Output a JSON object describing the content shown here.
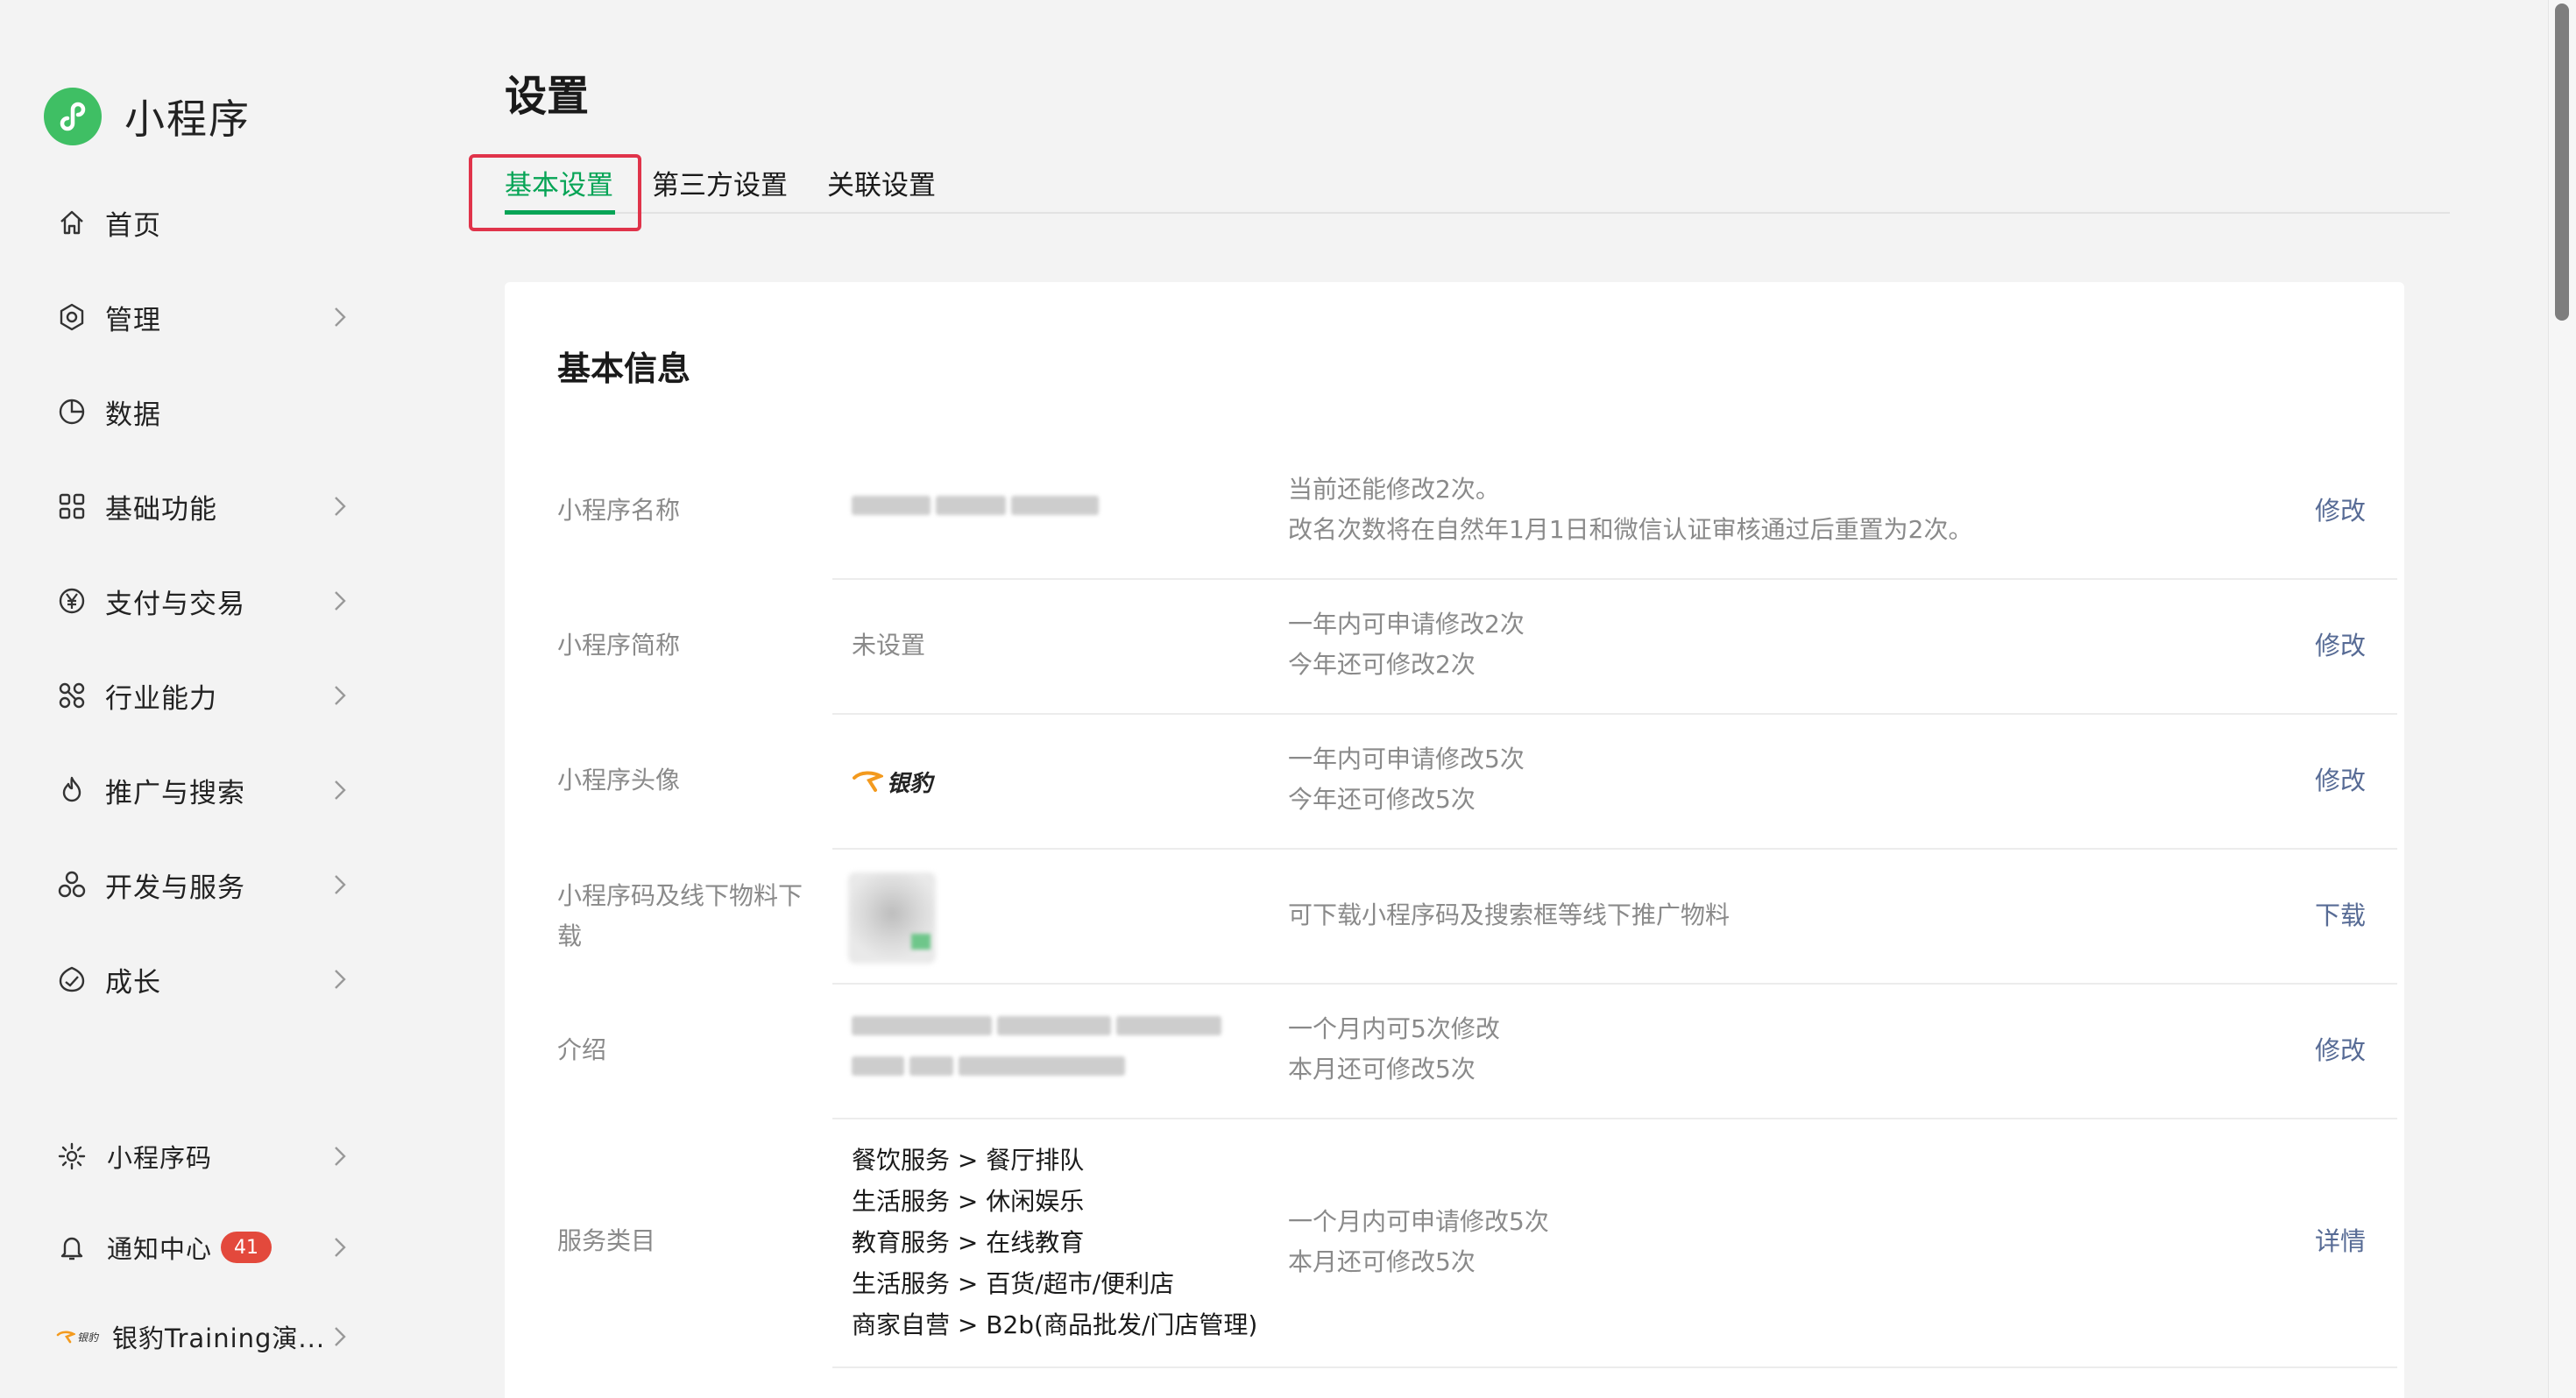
{
  "brand": {
    "name": "小程序"
  },
  "nav": [
    {
      "label": "首页",
      "icon": "home-icon",
      "chevron": false
    },
    {
      "label": "管理",
      "icon": "manage-icon",
      "chevron": true
    },
    {
      "label": "数据",
      "icon": "pie-chart-icon",
      "chevron": false
    },
    {
      "label": "基础功能",
      "icon": "grid-icon",
      "chevron": true
    },
    {
      "label": "支付与交易",
      "icon": "yen-icon",
      "chevron": true
    },
    {
      "label": "行业能力",
      "icon": "industry-icon",
      "chevron": true
    },
    {
      "label": "推广与搜索",
      "icon": "flame-icon",
      "chevron": true
    },
    {
      "label": "开发与服务",
      "icon": "cluster-icon",
      "chevron": true
    },
    {
      "label": "成长",
      "icon": "growth-icon",
      "chevron": true
    }
  ],
  "bottom_nav": {
    "qrcode": {
      "label": "小程序码"
    },
    "notify": {
      "label": "通知中心",
      "badge": "41"
    },
    "account": {
      "label": "银豹Training演...",
      "logo_text": "银豹"
    }
  },
  "page": {
    "title": "设置",
    "tabs": [
      "基本设置",
      "第三方设置",
      "关联设置"
    ],
    "active_tab": "基本设置"
  },
  "card": {
    "title": "基本信息",
    "rows": [
      {
        "label": "小程序名称",
        "desc": [
          "当前还能修改2次。",
          "改名次数将在自然年1月1日和微信认证审核通过后重置为2次。"
        ],
        "action": "修改"
      },
      {
        "label": "小程序简称",
        "value": "未设置",
        "desc": [
          "一年内可申请修改2次",
          "今年还可修改2次"
        ],
        "action": "修改"
      },
      {
        "label": "小程序头像",
        "value_logo_text": "银豹",
        "desc": [
          "一年内可申请修改5次",
          "今年还可修改5次"
        ],
        "action": "修改"
      },
      {
        "label": "小程序码及线下物料下载",
        "desc": [
          "可下载小程序码及搜索框等线下推广物料"
        ],
        "action": "下载"
      },
      {
        "label": "介绍",
        "desc": [
          "一个月内可5次修改",
          "本月还可修改5次"
        ],
        "action": "修改"
      },
      {
        "label": "服务类目",
        "categories": [
          "餐饮服务 > 餐厅排队",
          "生活服务 > 休闲娱乐",
          "教育服务 > 在线教育",
          "生活服务 > 百货/超市/便利店",
          "商家自营 > B2b(商品批发/门店管理)"
        ],
        "desc": [
          "一个月内可申请修改5次",
          "本月还可修改5次"
        ],
        "action": "详情"
      }
    ]
  },
  "colors": {
    "accent": "#07a456",
    "link": "#576b95",
    "badge": "#e3493c",
    "highlight": "#e0334a",
    "brand": "#3fbf64"
  }
}
